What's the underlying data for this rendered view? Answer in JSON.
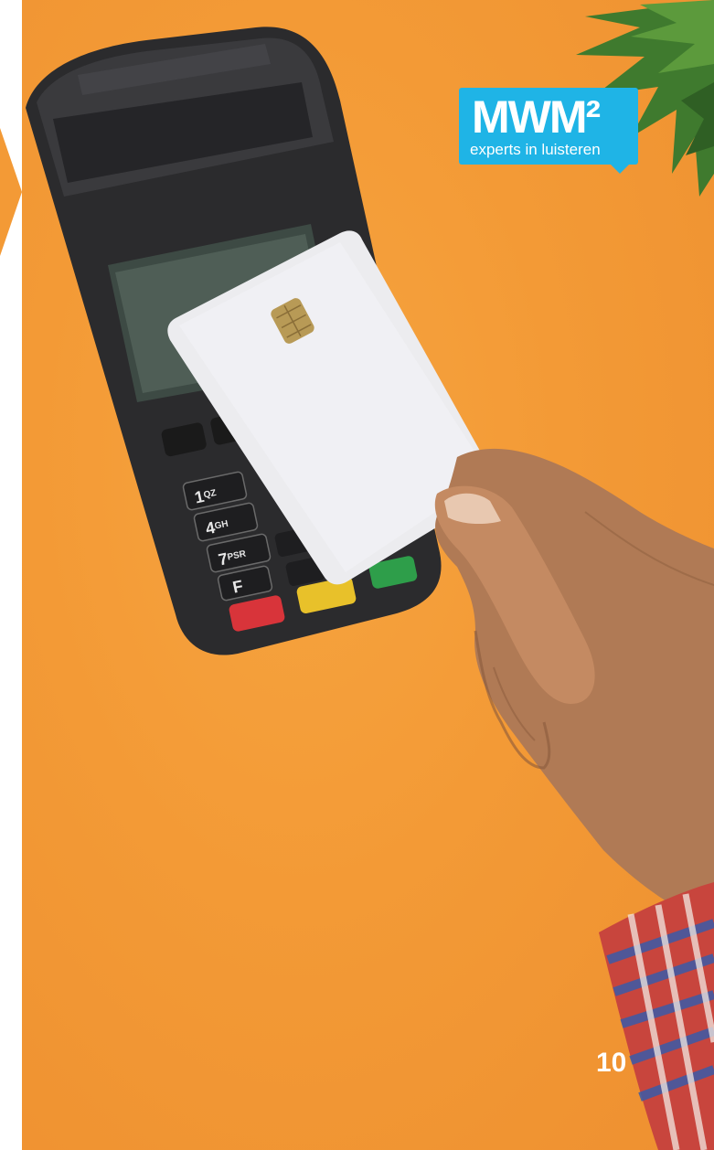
{
  "brand": {
    "logo_text": "MWM²",
    "tagline": "experts in luisteren",
    "color": "#1fb4e6"
  },
  "page_number": "10",
  "photo": {
    "background_color": "#f39a36",
    "terminal_keys": [
      {
        "digit": "1",
        "letters": "QZ"
      },
      {
        "digit": "4",
        "letters": "GH"
      },
      {
        "digit": "7",
        "letters": "PSR"
      },
      {
        "digit": "F",
        "letters": ""
      }
    ]
  }
}
